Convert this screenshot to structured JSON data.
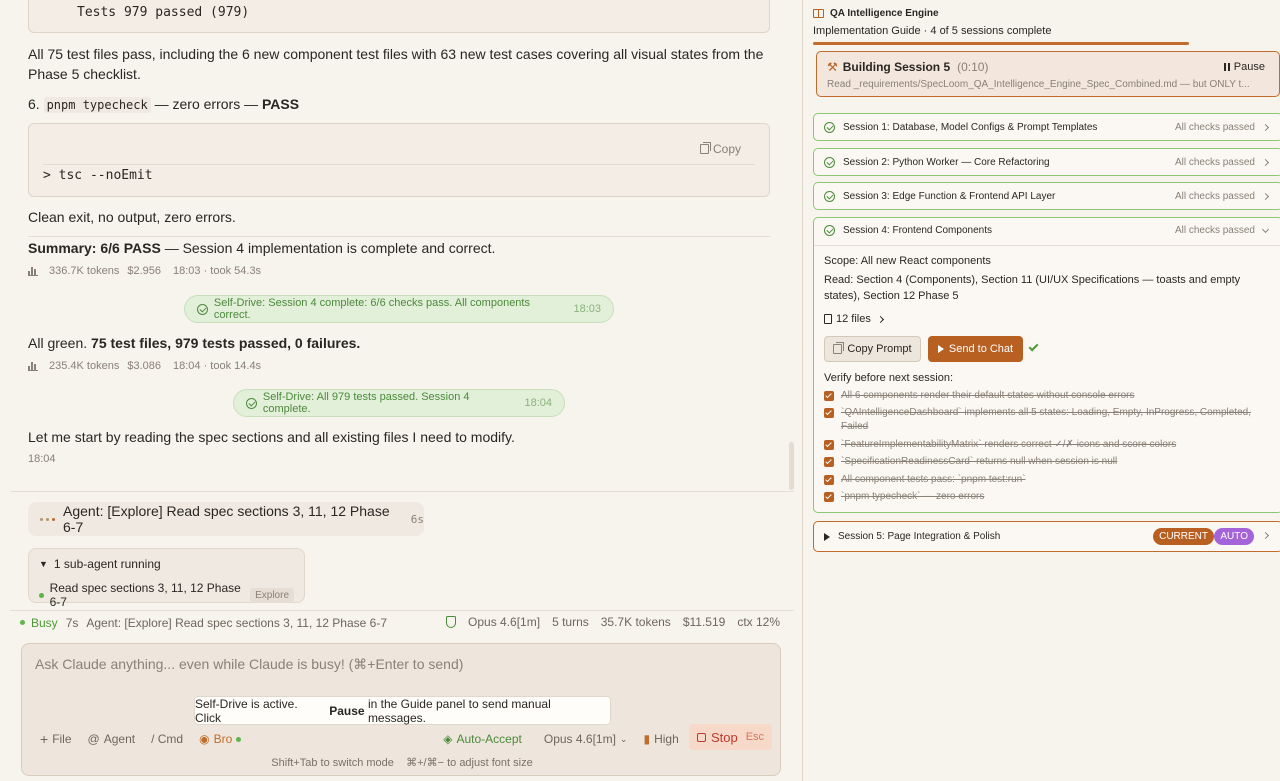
{
  "chat": {
    "tests_line": "Tests  979 passed (979)",
    "para1": "All 75 test files pass, including the 6 new component test files with 63 new test cases covering all visual states from the Phase 5 checklist.",
    "step6_num": "6.",
    "step6_code": "pnpm typecheck",
    "step6_mid": "— zero errors —",
    "step6_result": "PASS",
    "copy_label": "Copy",
    "cmd_line": "> tsc --noEmit",
    "clean_exit": "Clean exit, no output, zero errors.",
    "summary_bold": "Summary: 6/6 PASS",
    "summary_rest": "— Session 4 implementation is complete and correct.",
    "meta1_tokens": "336.7K tokens",
    "meta1_cost": "$2.956",
    "meta1_time": "18:03 · took 54.3s",
    "drive1_text": "Self-Drive: Session 4 complete: 6/6 checks pass. All components correct.",
    "drive1_time": "18:03",
    "allgreen_pre": "All green.",
    "allgreen_bold": "75 test files, 979 tests passed, 0 failures.",
    "meta2_tokens": "235.4K tokens",
    "meta2_cost": "$3.086",
    "meta2_time": "18:04 · took 14.4s",
    "drive2_text": "Self-Drive: All 979 tests passed. Session 4 complete.",
    "drive2_time": "18:04",
    "start_reading": "Let me start by reading the spec sections and all existing files I need to modify.",
    "start_time": "18:04",
    "agent_label": "Agent: [Explore] Read spec sections 3, 11, 12 Phase 6-7",
    "agent_time": "6s",
    "subagent_header": "1 sub-agent running",
    "subagent_item": "Read spec sections 3, 11, 12 Phase 6-7",
    "subagent_tag": "Explore"
  },
  "status": {
    "busy": "Busy",
    "elapsed": "7s",
    "agent": "Agent: [Explore] Read spec sections 3, 11, 12 Phase 6-7",
    "model": "Opus 4.6[1m]",
    "turns": "5 turns",
    "tokens": "35.7K tokens",
    "cost": "$11.519",
    "ctx": "ctx 12%"
  },
  "input": {
    "placeholder": "Ask Claude anything... even while Claude is busy! (⌘+Enter to send)",
    "tip_pre": "Self-Drive is active. Click",
    "tip_bold": "Pause",
    "tip_post": "in the Guide panel to send manual messages.",
    "file": "File",
    "agent": "Agent",
    "cmd": "/ Cmd",
    "bro": "Bro",
    "auto_accept": "Auto-Accept",
    "model": "Opus 4.6[1m]",
    "effort": "High",
    "stop": "Stop",
    "stop_key": "Esc",
    "hint_mode": "Shift+Tab to switch mode",
    "hint_font": "⌘+/⌘− to adjust font size"
  },
  "guide": {
    "title": "QA Intelligence Engine",
    "subtitle": "Implementation Guide · 4 of 5 sessions complete",
    "progress": 0.8,
    "building_title": "Building Session 5",
    "building_time": "(0:10)",
    "building_desc": "Read _requirements/SpecLoom_QA_Intelligence_Engine_Spec_Combined.md — but ONLY t...",
    "pause": "Pause",
    "sessions": [
      {
        "label": "Session 1: Database, Model Configs & Prompt Templates",
        "status": "All checks passed"
      },
      {
        "label": "Session 2: Python Worker — Core Refactoring",
        "status": "All checks passed"
      },
      {
        "label": "Session 3: Edge Function & Frontend API Layer",
        "status": "All checks passed"
      }
    ],
    "s4": {
      "label": "Session 4: Frontend Components",
      "status": "All checks passed",
      "scope_key": "Scope:",
      "scope_val": "All new React components",
      "read_key": "Read:",
      "read_val": "Section 4 (Components), Section 11 (UI/UX Specifications — toasts and empty states), Section 12 Phase 5",
      "files": "12 files",
      "copy_prompt": "Copy Prompt",
      "send_chat": "Send to Chat",
      "verify": "Verify before next session:",
      "checks": [
        "All 6 components render their default states without console errors",
        "`QAIntelligenceDashboard` implements all 5 states: Loading, Empty, InProgress, Completed, Failed",
        "`FeatureImplementabilityMatrix` renders correct ✓/✗ icons and score colors",
        "`SpecificationReadinessCard` returns null when session is null",
        "All component tests pass: `pnpm test:run`",
        "`pnpm typecheck` — zero errors"
      ]
    },
    "s5": {
      "label": "Session 5: Page Integration & Polish",
      "current": "CURRENT",
      "auto": "AUTO"
    }
  },
  "colors": {
    "accent": "#b85f22",
    "success": "#4c8a3b",
    "bg": "#f7f3ed",
    "auto_badge": "#a463d8"
  }
}
